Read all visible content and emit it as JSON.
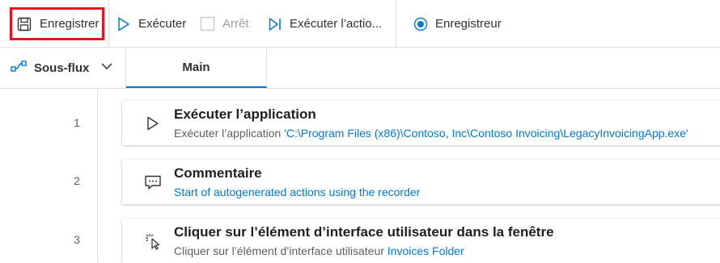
{
  "toolbar": {
    "save_label": "Enregistrer",
    "run_label": "Exécuter",
    "stop_label": "Arrêt",
    "run_next_label": "Exécuter l’actio...",
    "recorder_label": "Enregistreur"
  },
  "tabs": {
    "subflows_label": "Sous-flux",
    "main_label": "Main"
  },
  "actions": [
    {
      "line": "1",
      "title": "Exécuter l’application",
      "desc_prefix": "Exécuter l’application ",
      "desc_link": "'C:\\Program Files (x86)\\Contoso, Inc\\Contoso Invoicing\\LegacyInvoicingApp.exe'",
      "icon": "play-icon"
    },
    {
      "line": "2",
      "title": "Commentaire",
      "desc_prefix": "",
      "desc_link": "Start of autogenerated actions using the recorder",
      "icon": "comment-icon"
    },
    {
      "line": "3",
      "title": "Cliquer sur l’élément d’interface utilisateur dans la fenêtre",
      "desc_prefix": "Cliquer sur l’élément d’interface utilisateur ",
      "desc_link": "Invoices Folder",
      "icon": "click-icon"
    }
  ],
  "colors": {
    "accent": "#0078d4",
    "highlight": "#e81123",
    "disabled": "#a19f9d"
  }
}
